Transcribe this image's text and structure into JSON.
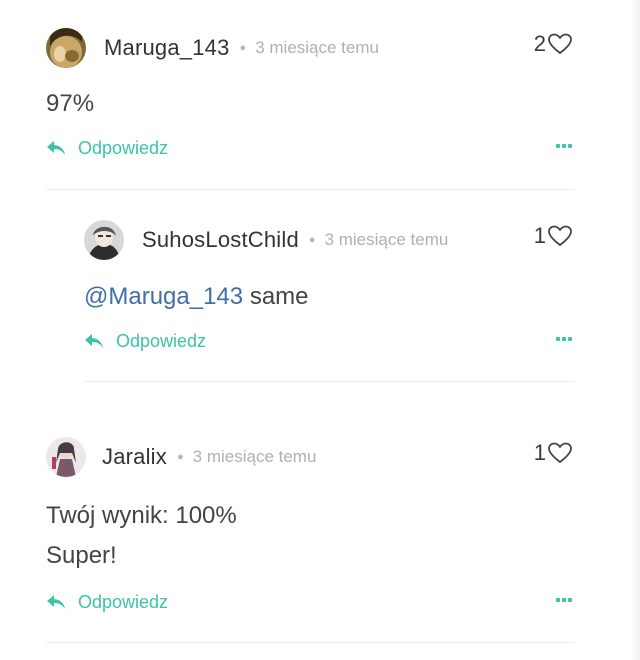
{
  "comments": [
    {
      "username": "Maruga_143",
      "time": "3 miesiące temu",
      "likes": "2",
      "text": "97%",
      "reply_label": "Odpowiedz"
    },
    {
      "username": "SuhosLostChild",
      "time": "3 miesiące temu",
      "likes": "1",
      "mention": "@Maruga_143",
      "text": "same",
      "reply_label": "Odpowiedz"
    },
    {
      "username": "Jaralix",
      "time": "3 miesiące temu",
      "likes": "1",
      "text_line1": "Twój wynik: 100%",
      "text_line2": "Super!",
      "reply_label": "Odpowiedz"
    }
  ],
  "colors": {
    "accent": "#3cc3a8",
    "mention": "#3f6fa8",
    "muted": "#b0b0b0",
    "text": "#444444"
  },
  "icons": {
    "like": "heart-icon",
    "reply": "reply-arrow-icon",
    "more": "more-dots-icon"
  }
}
